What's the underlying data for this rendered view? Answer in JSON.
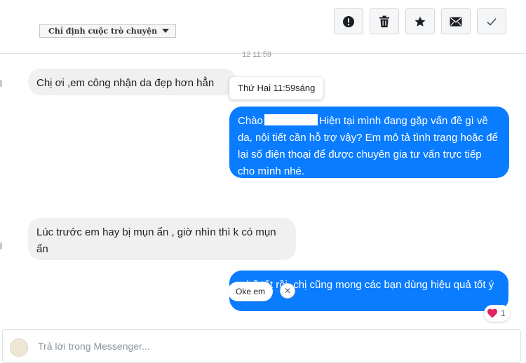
{
  "header": {
    "assign_label": "Chỉ định cuộc trò chuyện",
    "actions": [
      {
        "name": "mark-spam",
        "icon": "exclamation-circle-icon"
      },
      {
        "name": "delete",
        "icon": "trash-icon"
      },
      {
        "name": "star",
        "icon": "star-icon"
      },
      {
        "name": "mark-unread",
        "icon": "envelope-icon"
      },
      {
        "name": "mark-done",
        "icon": "checkmark-icon"
      }
    ]
  },
  "timestamp": "12 11:59",
  "tooltip": "Thứ Hai 11:59sáng",
  "messages": {
    "m1": "Chị ơi ,em công nhận da đẹp hơn hẳn",
    "m2_greeting": "Chào",
    "m2_rest": "Hiện tại mình đang gặp vấn đề gì về da, nội tiết cần hỗ trợ vậy? Em mô tả tình trạng hoặc để lại số điện thoại để được chuyên gia tư vấn trực tiếp cho mình nhé.",
    "m3": "Lúc trước em hay bị mụn ẩn , giờ nhìn thì k có mụn ẩn",
    "m4": "...hế tốt rồi, chị cũng mong các bạn dùng hiệu quả tốt ý"
  },
  "quick_reply": {
    "label": "Oke em",
    "close_glyph": "✕"
  },
  "reaction": {
    "emoji_icon": "heart-icon",
    "count": "1",
    "color": "#e0245e"
  },
  "composer": {
    "placeholder": "Trả lời trong Messenger..."
  },
  "colors": {
    "outgoing_bubble": "#0a7cff",
    "incoming_bubble": "#f0f0f0"
  }
}
